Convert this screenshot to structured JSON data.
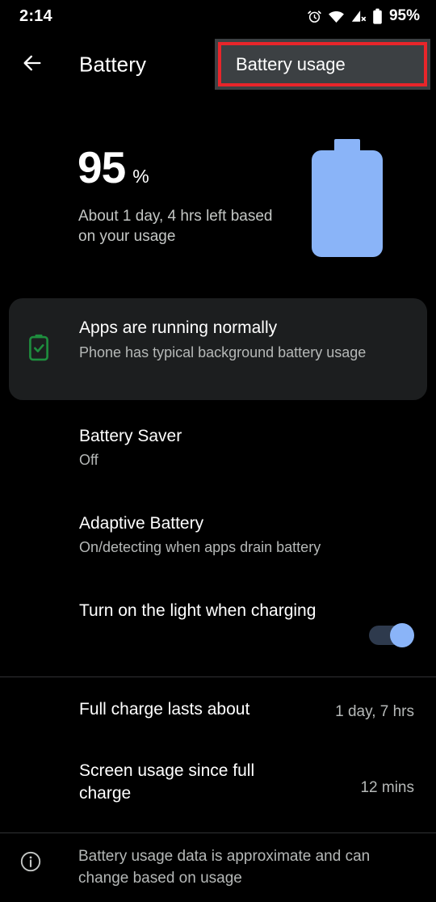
{
  "statusbar": {
    "time": "2:14",
    "battery_percent": "95%",
    "icons": [
      "alarm-icon",
      "wifi-icon",
      "no-sim-signal-icon",
      "battery-icon"
    ]
  },
  "appbar": {
    "back_icon": "back-arrow-icon",
    "title": "Battery",
    "action_button": {
      "label": "Battery usage",
      "highlight_color": "#e8252a",
      "background": "#3c4043"
    }
  },
  "summary": {
    "percent_value": "95",
    "percent_sign": "%",
    "estimate": "About 1 day, 4 hrs left based on your usage",
    "battery_graphic_color": "#8ab4f8"
  },
  "status_card": {
    "icon": "battery-check-icon",
    "icon_color": "#1e8e3e",
    "title": "Apps are running normally",
    "subtitle": "Phone has typical background battery usage"
  },
  "settings": [
    {
      "name": "battery-saver",
      "title": "Battery Saver",
      "subtitle": "Off"
    },
    {
      "name": "adaptive-battery",
      "title": "Adaptive Battery",
      "subtitle": "On/detecting when apps drain battery"
    },
    {
      "name": "charging-light",
      "title": "Turn on the light when charging",
      "toggle": true,
      "toggle_on": true
    }
  ],
  "stats": [
    {
      "name": "full-charge-lasts",
      "title": "Full charge lasts about",
      "value": "1 day, 7 hrs"
    },
    {
      "name": "screen-usage",
      "title": "Screen usage since full charge",
      "value": "12 mins"
    }
  ],
  "footer": {
    "icon": "info-icon",
    "text": "Battery usage data is approximate and can change based on usage"
  }
}
